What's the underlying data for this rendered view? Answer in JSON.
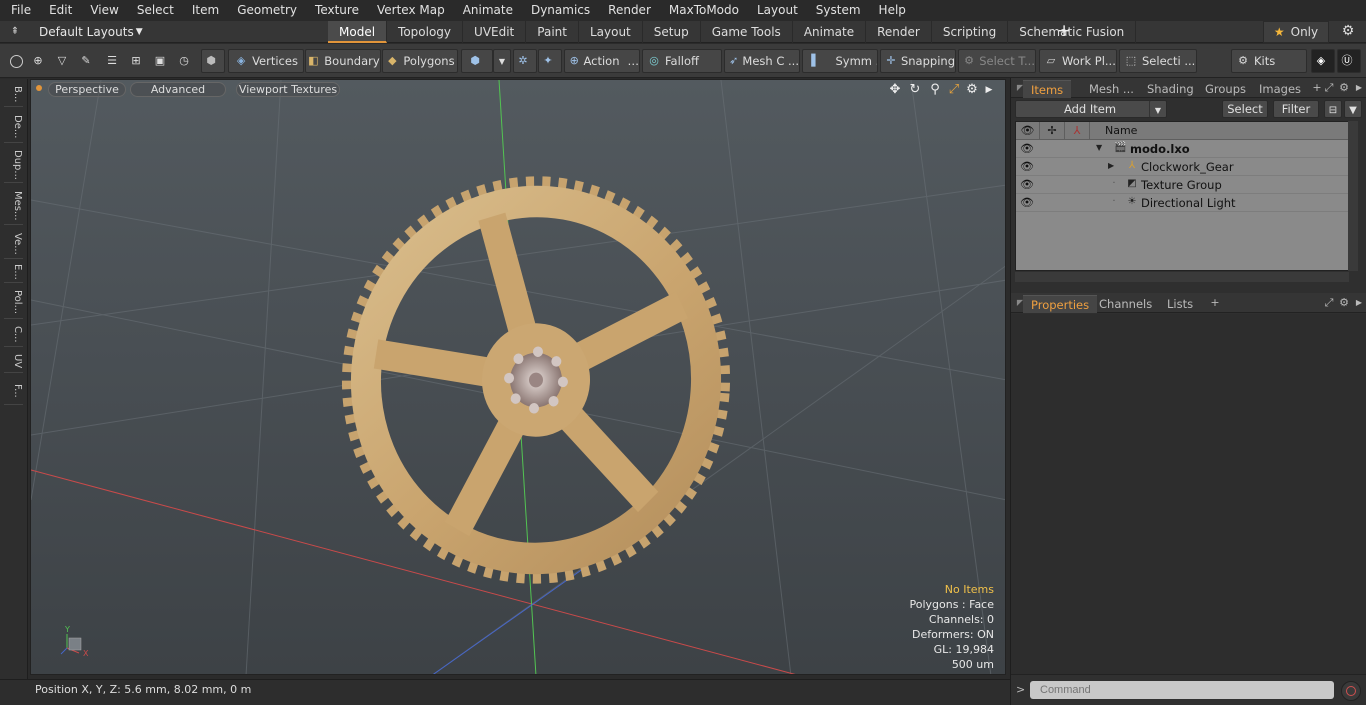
{
  "menu": [
    "File",
    "Edit",
    "View",
    "Select",
    "Item",
    "Geometry",
    "Texture",
    "Vertex Map",
    "Animate",
    "Dynamics",
    "Render",
    "MaxToModo",
    "Layout",
    "System",
    "Help"
  ],
  "layoutbar": {
    "layout_dropdown": "Default Layouts",
    "tabs": [
      "Model",
      "Topology",
      "UVEdit",
      "Paint",
      "Layout",
      "Setup",
      "Game Tools",
      "Animate",
      "Render",
      "Scripting",
      "Schematic Fusion"
    ],
    "active_tab": "Model",
    "only_label": "Only"
  },
  "toolbar": {
    "vertices": "Vertices",
    "boundary": "Boundary",
    "polygons": "Polygons",
    "action": "Action",
    "falloff": "Falloff",
    "mesh_c": "Mesh C ...",
    "symm": "Symm ...",
    "snapping": "Snapping",
    "select_t": "Select T...",
    "work_pl": "Work Pl...",
    "selecti": "Selecti ...",
    "kits": "Kits"
  },
  "viewport": {
    "perspective": "Perspective",
    "advanced": "Advanced",
    "viewport_textures": "Viewport Textures",
    "info": {
      "no_items": "No Items",
      "polygons": "Polygons : Face",
      "channels": "Channels: 0",
      "deformers": "Deformers: ON",
      "gl": "GL: 19,984",
      "units": "500 um"
    }
  },
  "left_tabs": [
    "B...",
    "De...",
    "Dup...",
    "Mes...",
    "Ve...",
    "E...",
    "Pol...",
    "C...",
    "UV",
    "F..."
  ],
  "status": {
    "position": "Position X, Y, Z:   5.6 mm, 8.02 mm, 0 m"
  },
  "items_panel": {
    "tabs": [
      "Items",
      "Mesh ...",
      "Shading",
      "Groups",
      "Images"
    ],
    "active_tab": "Items",
    "add_item": "Add Item",
    "select": "Select",
    "filter": "Filter",
    "column_name": "Name",
    "rows": [
      {
        "label": "modo.lxo",
        "bold": true
      },
      {
        "label": "Clockwork_Gear",
        "bold": false
      },
      {
        "label": "Texture Group",
        "bold": false
      },
      {
        "label": "Directional Light",
        "bold": false
      }
    ]
  },
  "properties_panel": {
    "tabs": [
      "Properties",
      "Channels",
      "Lists"
    ],
    "active_tab": "Properties"
  },
  "command": {
    "placeholder": "Command"
  }
}
